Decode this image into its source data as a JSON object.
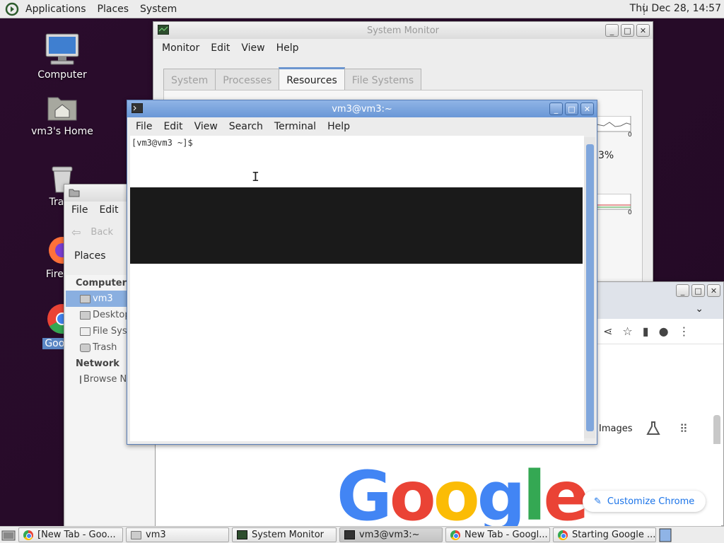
{
  "top_panel": {
    "menus": [
      "Applications",
      "Places",
      "System"
    ],
    "clock": "Thu Dec 28, 14:57"
  },
  "desktop": {
    "icons": [
      {
        "label": "Computer",
        "icon": "computer-icon"
      },
      {
        "label": "vm3's Home",
        "icon": "home-folder-icon"
      },
      {
        "label": "Trash",
        "icon": "trash-icon"
      },
      {
        "label": "Firefox",
        "icon": "firefox-icon"
      },
      {
        "label": "Google",
        "icon": "chrome-icon"
      }
    ]
  },
  "system_monitor": {
    "title": "System Monitor",
    "menus": [
      "Monitor",
      "Edit",
      "View",
      "Help"
    ],
    "tabs": [
      "System",
      "Processes",
      "Resources",
      "File Systems"
    ],
    "active_tab": "Resources",
    "graph_axis_zero_1": "0",
    "graph_axis_zero_2": "0",
    "percent_partial": "3%"
  },
  "file_manager": {
    "menus": [
      "File",
      "Edit"
    ],
    "back_label": "Back",
    "places_label": "Places",
    "sections": [
      {
        "heading": "Computer",
        "items": [
          {
            "label": "vm3",
            "selected": true
          },
          {
            "label": "Desktop",
            "selected": false
          },
          {
            "label": "File System",
            "selected": false
          },
          {
            "label": "Trash",
            "selected": false
          }
        ]
      },
      {
        "heading": "Network",
        "items": [
          {
            "label": "Browse Network",
            "selected": false
          }
        ]
      }
    ]
  },
  "terminal": {
    "title": "vm3@vm3:~",
    "menus": [
      "File",
      "Edit",
      "View",
      "Search",
      "Terminal",
      "Help"
    ],
    "prompt": "[vm3@vm3 ~]$"
  },
  "chrome": {
    "images_link": "Images",
    "google_logo": "Google",
    "customize_button": "Customize Chrome",
    "logo_colors": [
      "#4285f4",
      "#ea4335",
      "#fbbc05",
      "#4285f4",
      "#34a853",
      "#ea4335"
    ]
  },
  "taskbar": {
    "tasks": [
      {
        "label": "[New Tab - Goo...",
        "icon": "chrome-icon"
      },
      {
        "label": "vm3",
        "icon": "folder-icon"
      },
      {
        "label": "System Monitor",
        "icon": "system-monitor-icon"
      },
      {
        "label": "vm3@vm3:~",
        "icon": "terminal-icon",
        "current": true
      },
      {
        "label": "New Tab - Googl...",
        "icon": "chrome-icon"
      },
      {
        "label": "Starting Google ...",
        "icon": "chrome-icon"
      }
    ]
  }
}
